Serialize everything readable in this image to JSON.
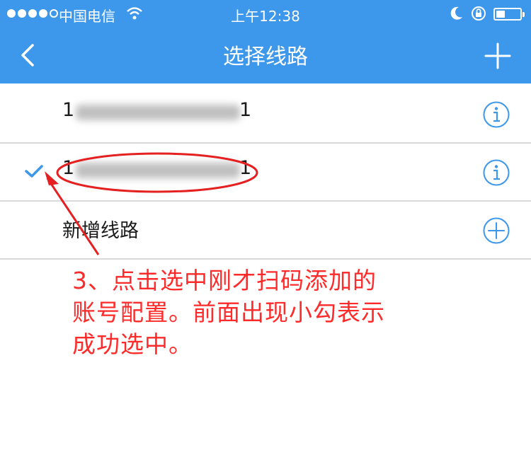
{
  "status_bar": {
    "carrier": "中国电信",
    "time": "上午12:38"
  },
  "nav": {
    "title": "选择线路"
  },
  "routes": [
    {
      "label": "1",
      "label_end": "1",
      "selected": false
    },
    {
      "label": "1",
      "label_end": "1",
      "selected": true
    },
    {
      "label": "新增线路"
    }
  ],
  "annotation": {
    "text": "3、点击选中刚才扫码添加的\n账号配置。前面出现小勾表示\n成功选中。",
    "color": "#ff2a2a"
  },
  "colors": {
    "accent": "#3d97ea",
    "annotation": "#e42020"
  }
}
